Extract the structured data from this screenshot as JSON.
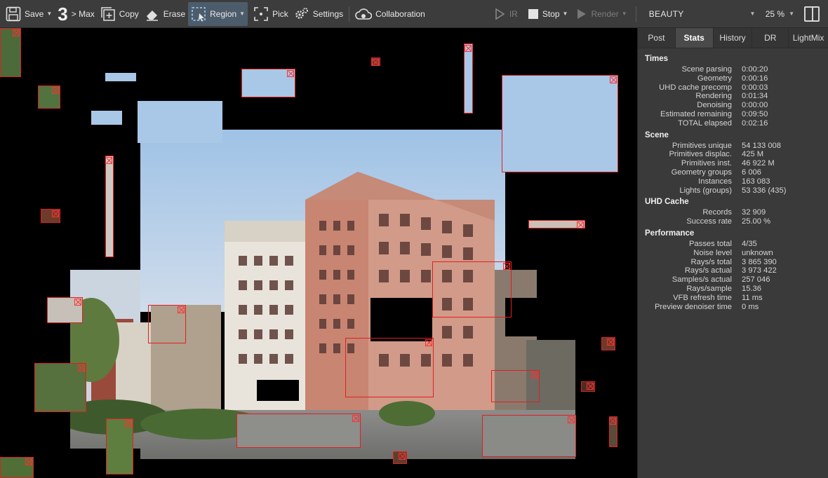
{
  "toolbar": {
    "save": "Save",
    "max_num": "3",
    "max": "> Max",
    "copy": "Copy",
    "erase": "Erase",
    "region": "Region",
    "pick": "Pick",
    "settings": "Settings",
    "collaboration": "Collaboration",
    "ir": "IR",
    "stop": "Stop",
    "render": "Render",
    "channel": "BEAUTY",
    "zoom": "25 %"
  },
  "tabs": [
    "Post",
    "Stats",
    "History",
    "DR",
    "LightMix"
  ],
  "stats": {
    "times_title": "Times",
    "times": [
      {
        "k": "Scene parsing",
        "v": "0:00:20"
      },
      {
        "k": "Geometry",
        "v": "0:00:16"
      },
      {
        "k": "UHD cache precomp",
        "v": "0:00:03"
      },
      {
        "k": "Rendering",
        "v": "0:01:34"
      },
      {
        "k": "Denoising",
        "v": "0:00:00"
      },
      {
        "k": "Estimated remaining",
        "v": "0:09:50"
      },
      {
        "k": "TOTAL elapsed",
        "v": "0:02:16"
      }
    ],
    "scene_title": "Scene",
    "scene": [
      {
        "k": "Primitives unique",
        "v": "54 133 008"
      },
      {
        "k": "Primitives displac.",
        "v": "425 M"
      },
      {
        "k": "Primitives inst.",
        "v": "46 922 M"
      },
      {
        "k": "Geometry groups",
        "v": "6 006"
      },
      {
        "k": "Instances",
        "v": "163 083"
      },
      {
        "k": "Lights (groups)",
        "v": "53 336 (435)"
      }
    ],
    "uhd_title": "UHD Cache",
    "uhd": [
      {
        "k": "Records",
        "v": "32 909"
      },
      {
        "k": "Success rate",
        "v": "25.00 %"
      }
    ],
    "perf_title": "Performance",
    "perf": [
      {
        "k": "Passes total",
        "v": "4/35"
      },
      {
        "k": "Noise level",
        "v": "unknown"
      },
      {
        "k": "Rays/s total",
        "v": "3 865 390"
      },
      {
        "k": "Rays/s actual",
        "v": "3 973 422"
      },
      {
        "k": "Samples/s actual",
        "v": "257 046"
      },
      {
        "k": "Rays/sample",
        "v": "15.36"
      },
      {
        "k": "VFB refresh time",
        "v": "11 ms"
      },
      {
        "k": "Preview denoiser time",
        "v": "0 ms"
      }
    ]
  }
}
